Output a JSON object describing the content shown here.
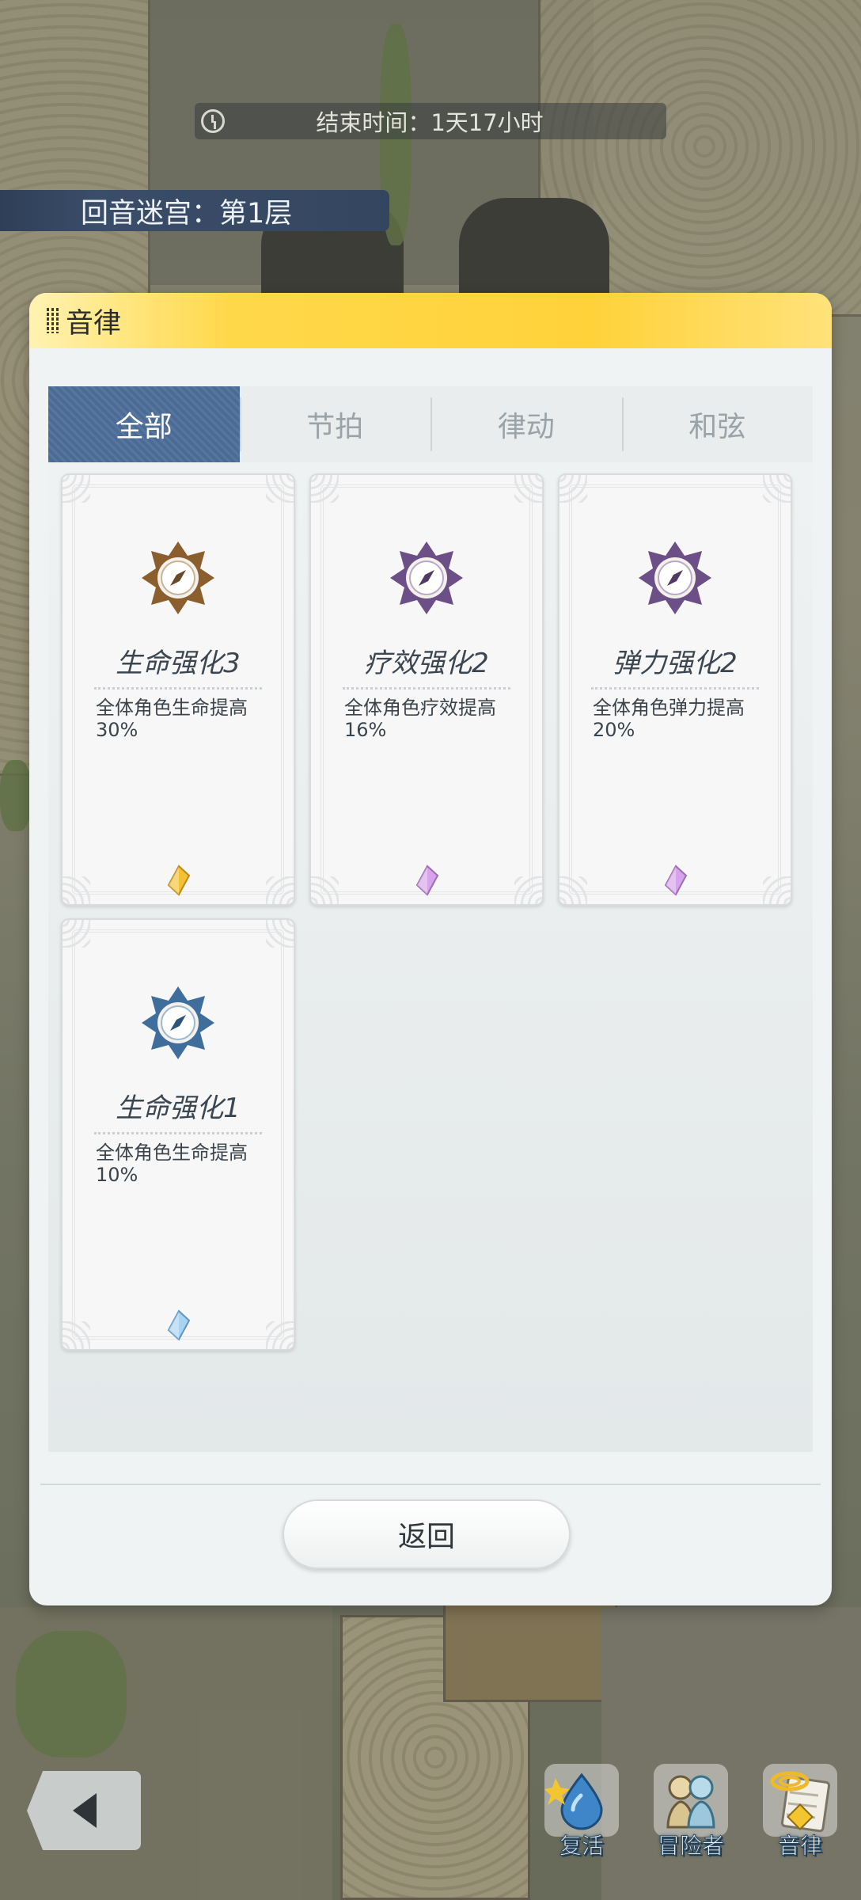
{
  "hud": {
    "timer_text": "结束时间：1天17小时",
    "floor_text": "回音迷宫：第1层"
  },
  "dialog": {
    "title": "音律",
    "tabs": [
      {
        "label": "全部",
        "active": true
      },
      {
        "label": "节拍",
        "active": false
      },
      {
        "label": "律动",
        "active": false
      },
      {
        "label": "和弦",
        "active": false
      }
    ],
    "cards": [
      {
        "name": "生命强化3",
        "desc_line1": "全体角色生命提高",
        "desc_line2": "30%",
        "emblem_color": "#8b5e2e",
        "gem_color": "#f2c234"
      },
      {
        "name": "疗效强化2",
        "desc_line1": "全体角色疗效提高",
        "desc_line2": "16%",
        "emblem_color": "#6b4f86",
        "gem_color": "#d7a3ea"
      },
      {
        "name": "弹力强化2",
        "desc_line1": "全体角色弹力提高",
        "desc_line2": "20%",
        "emblem_color": "#6b4f86",
        "gem_color": "#d7a3ea"
      },
      {
        "name": "生命强化1",
        "desc_line1": "全体角色生命提高",
        "desc_line2": "10%",
        "emblem_color": "#3f6e9c",
        "gem_color": "#a9d3f2"
      }
    ],
    "back_label": "返回"
  },
  "bottom_hud": {
    "buttons": [
      {
        "label": "复活",
        "icon": "revive-icon"
      },
      {
        "label": "冒险者",
        "icon": "adventurer-icon"
      },
      {
        "label": "音律",
        "icon": "melody-icon"
      }
    ]
  }
}
